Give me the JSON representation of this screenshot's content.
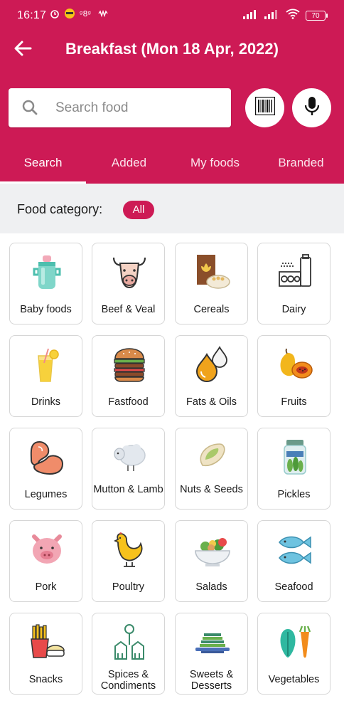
{
  "status_bar": {
    "time": "16:17",
    "battery": "70",
    "icons": [
      "alarm-icon",
      "emoji-icon",
      "nfc-icon",
      "vibration-icon",
      "signal-icon",
      "signal-icon",
      "wifi-icon",
      "battery-icon"
    ]
  },
  "toolbar": {
    "title": "Breakfast (Mon 18 Apr, 2022)",
    "back_icon": "back-arrow-icon"
  },
  "search": {
    "placeholder": "Search food",
    "value": "",
    "barcode_icon": "barcode-icon",
    "mic_icon": "microphone-icon"
  },
  "tabs": [
    {
      "label": "Search",
      "active": true
    },
    {
      "label": "Added",
      "active": false
    },
    {
      "label": "My foods",
      "active": false
    },
    {
      "label": "Branded",
      "active": false
    }
  ],
  "filter": {
    "label": "Food category:",
    "chip": "All"
  },
  "categories": [
    {
      "label": "Baby foods",
      "icon": "baby-bottle-icon"
    },
    {
      "label": "Beef & Veal",
      "icon": "cow-icon"
    },
    {
      "label": "Cereals",
      "icon": "cereal-icon"
    },
    {
      "label": "Dairy",
      "icon": "dairy-icon"
    },
    {
      "label": "Drinks",
      "icon": "drink-icon"
    },
    {
      "label": "Fastfood",
      "icon": "burger-icon"
    },
    {
      "label": "Fats & Oils",
      "icon": "oil-drop-icon"
    },
    {
      "label": "Fruits",
      "icon": "fruit-icon"
    },
    {
      "label": "Legumes",
      "icon": "bean-icon"
    },
    {
      "label": "Mutton & Lamb",
      "icon": "sheep-icon"
    },
    {
      "label": "Nuts & Seeds",
      "icon": "pistachio-icon"
    },
    {
      "label": "Pickles",
      "icon": "pickle-jar-icon"
    },
    {
      "label": "Pork",
      "icon": "pig-icon"
    },
    {
      "label": "Poultry",
      "icon": "chicken-icon"
    },
    {
      "label": "Salads",
      "icon": "salad-icon"
    },
    {
      "label": "Seafood",
      "icon": "fish-icon"
    },
    {
      "label": "Snacks",
      "icon": "fries-icon"
    },
    {
      "label": "Spices & Condiments",
      "icon": "spices-icon"
    },
    {
      "label": "Sweets & Desserts",
      "icon": "dessert-icon"
    },
    {
      "label": "Vegetables",
      "icon": "vegetables-icon"
    }
  ],
  "colors": {
    "brand": "#cd1a55",
    "filter_bg": "#eff0f2",
    "tile_border": "#d6d6d6"
  }
}
